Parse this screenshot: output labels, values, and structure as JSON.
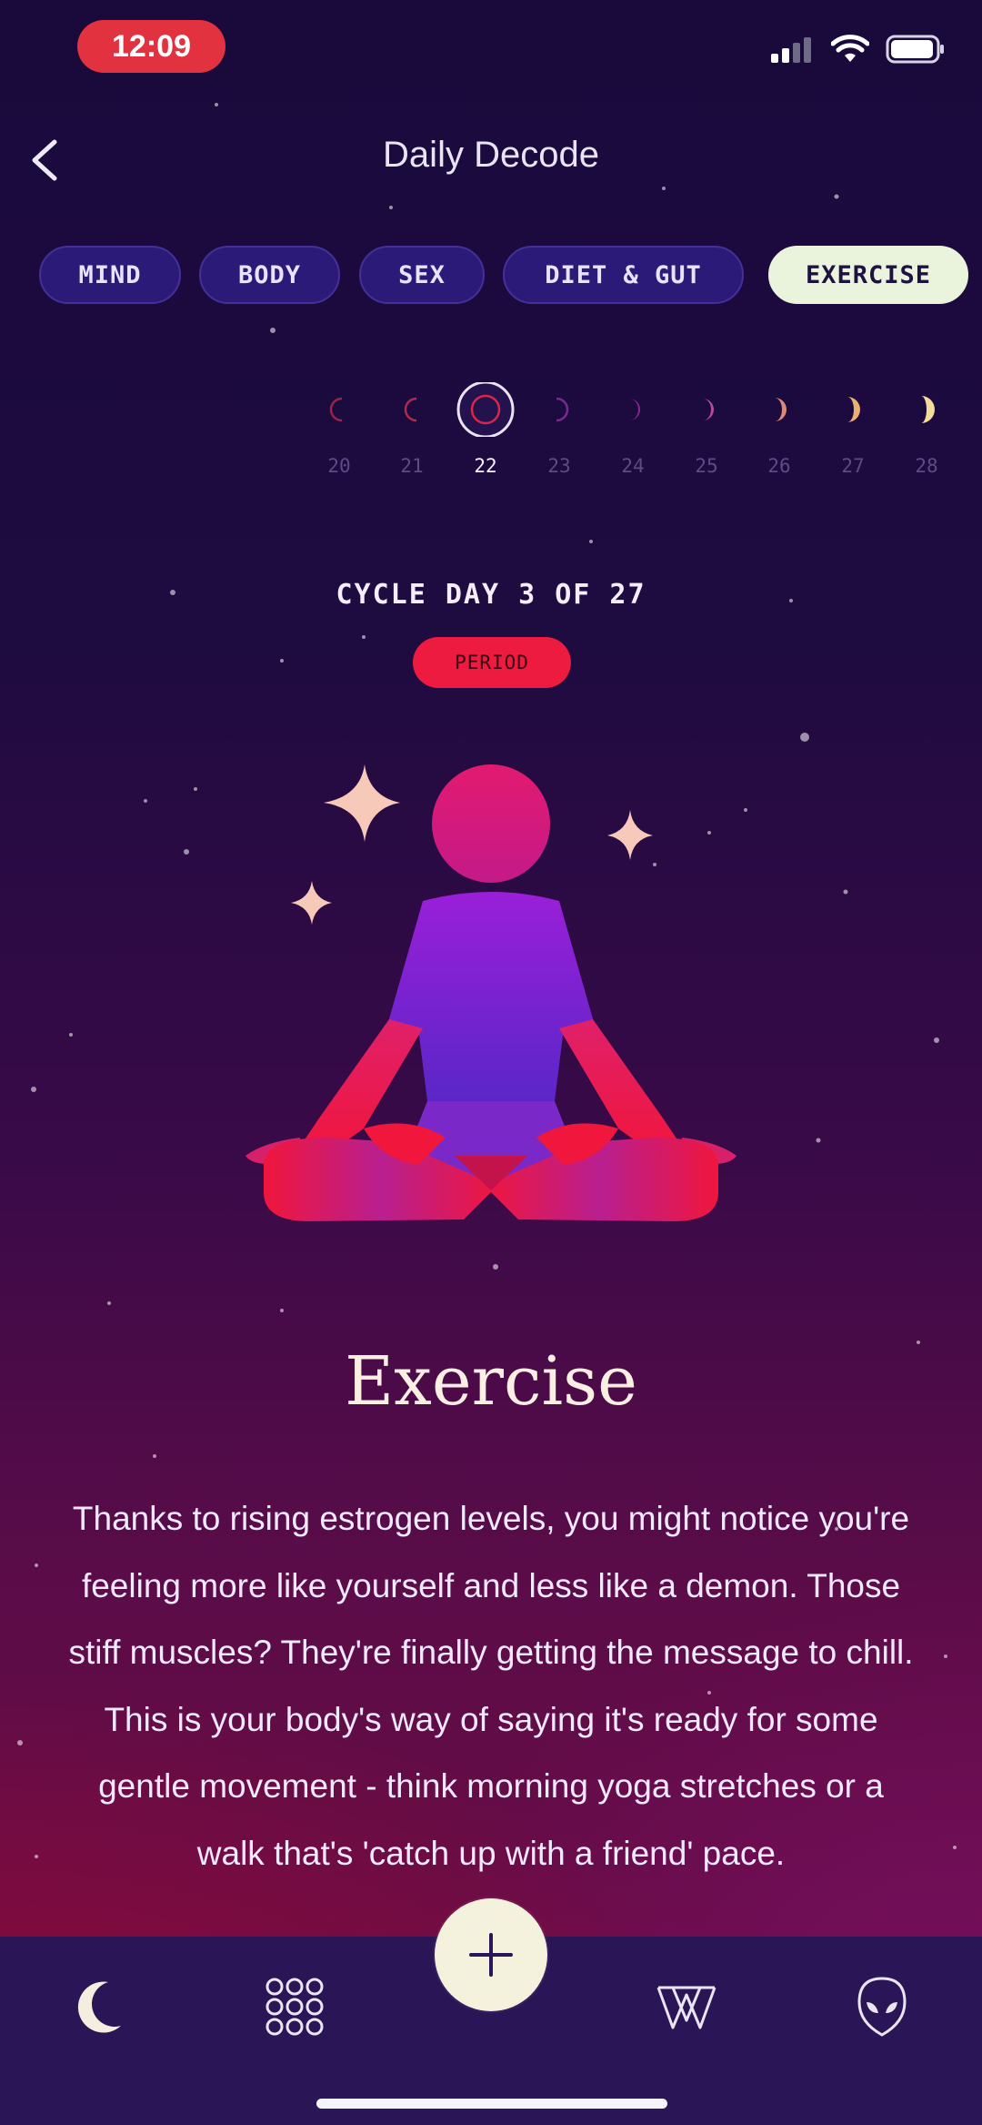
{
  "status": {
    "time": "12:09"
  },
  "header": {
    "title": "Daily Decode"
  },
  "tabs": [
    {
      "label": "MIND",
      "active": false
    },
    {
      "label": "BODY",
      "active": false
    },
    {
      "label": "SEX",
      "active": false
    },
    {
      "label": "DIET & GUT",
      "active": false
    },
    {
      "label": "EXERCISE",
      "active": true
    }
  ],
  "dates": [
    {
      "day": "20",
      "selected": false
    },
    {
      "day": "21",
      "selected": false
    },
    {
      "day": "22",
      "selected": true
    },
    {
      "day": "23",
      "selected": false
    },
    {
      "day": "24",
      "selected": false
    },
    {
      "day": "25",
      "selected": false
    },
    {
      "day": "26",
      "selected": false
    },
    {
      "day": "27",
      "selected": false
    },
    {
      "day": "28",
      "selected": false
    }
  ],
  "cycle": {
    "label": "CYCLE DAY 3 OF 27",
    "phase": "PERIOD"
  },
  "content": {
    "heading": "Exercise",
    "body": "Thanks to rising estrogen levels, you might notice you're feeling more like yourself and less like a demon. Those stiff muscles? They're finally getting the message to chill. This is your body's way of saying it's ready for some gentle movement - think morning yoga stretches or a walk that's 'catch up with a friend' pace."
  },
  "nav": {
    "items": [
      "moon-icon",
      "grid-icon",
      "add-icon",
      "w-icon",
      "alien-icon"
    ]
  },
  "colors": {
    "accent": "#ec1b3f",
    "active_tab": "#eaf3dc",
    "tab": "#2b1a78"
  }
}
